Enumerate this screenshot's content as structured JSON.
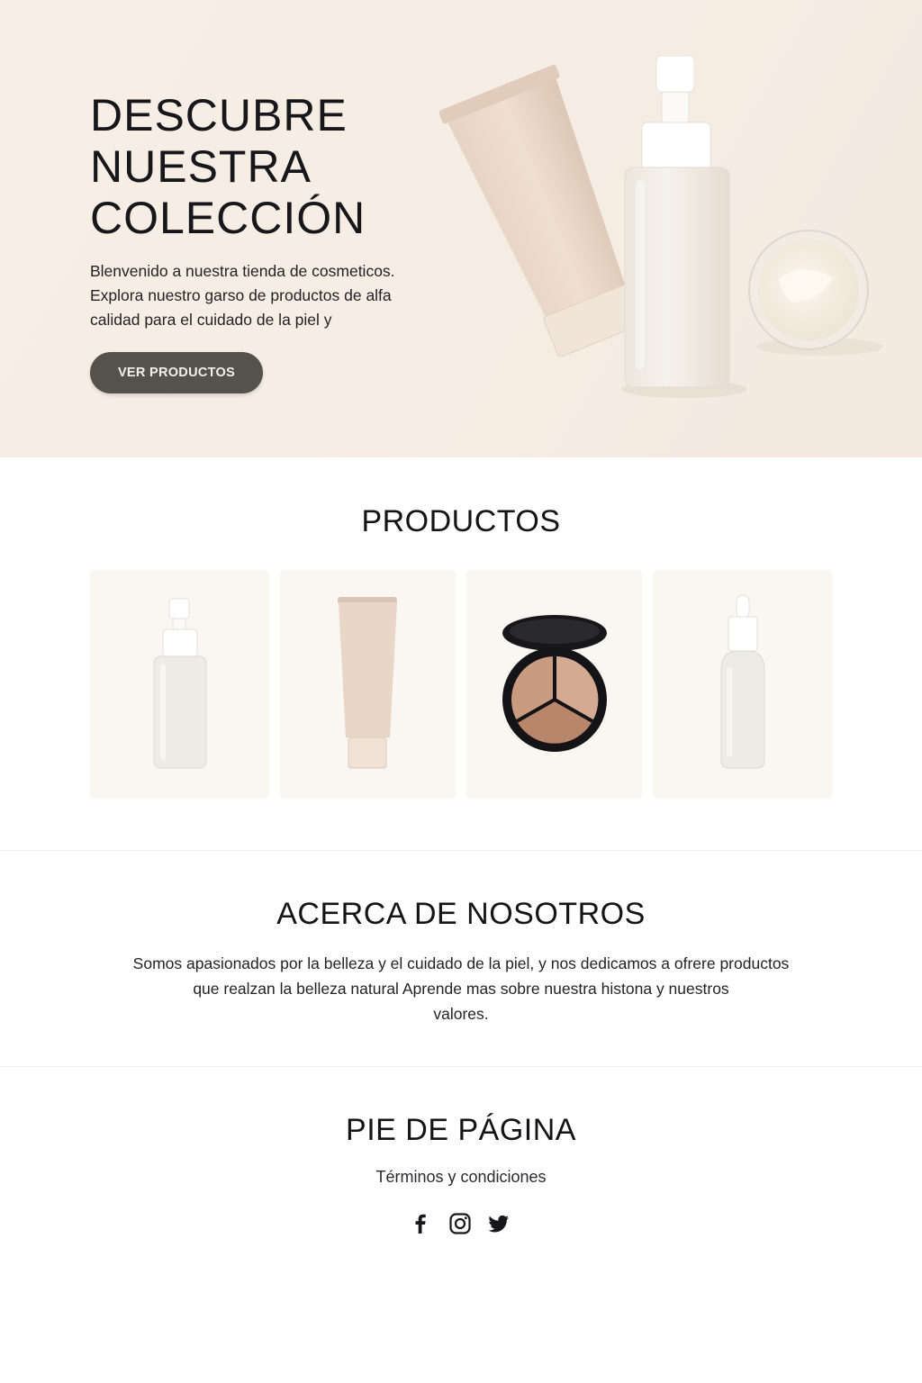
{
  "hero": {
    "title_lines": [
      "DESCUBRE",
      "NUESTRA",
      "COLECCIÓN"
    ],
    "text_lines": [
      "Blenvenido a nuestra tienda de cosmeticos.",
      "Explora nuestro garso de productos de alfa",
      "calidad para el cuidado de la piel y"
    ],
    "button_label": "VER PRODUCTOS",
    "background_color": "#f6ede4"
  },
  "products": {
    "title": "PRODUCTOS",
    "items": [
      {
        "icon": "spray-bottle-icon"
      },
      {
        "icon": "tube-icon"
      },
      {
        "icon": "concealer-palette-icon"
      },
      {
        "icon": "dropper-bottle-icon"
      }
    ]
  },
  "about": {
    "title": "ACERCA DE NOSOTROS",
    "text_lines": [
      "Somos apasionados por la belleza y el cuidado de la piel, y nos dedicamos a ofrere productos",
      "que realzan la belleza natural  Aprende mas sobre nuestra histona y nuestros",
      "valores."
    ]
  },
  "footer": {
    "title": "PIE DE PÁGINA",
    "terms_label": "Términos y condiciones",
    "social_icons": [
      "facebook-icon",
      "instagram-icon",
      "twitter-icon"
    ]
  },
  "colors": {
    "button": "#55514c",
    "card_background": "#faf6f1",
    "text": "#16161a"
  }
}
